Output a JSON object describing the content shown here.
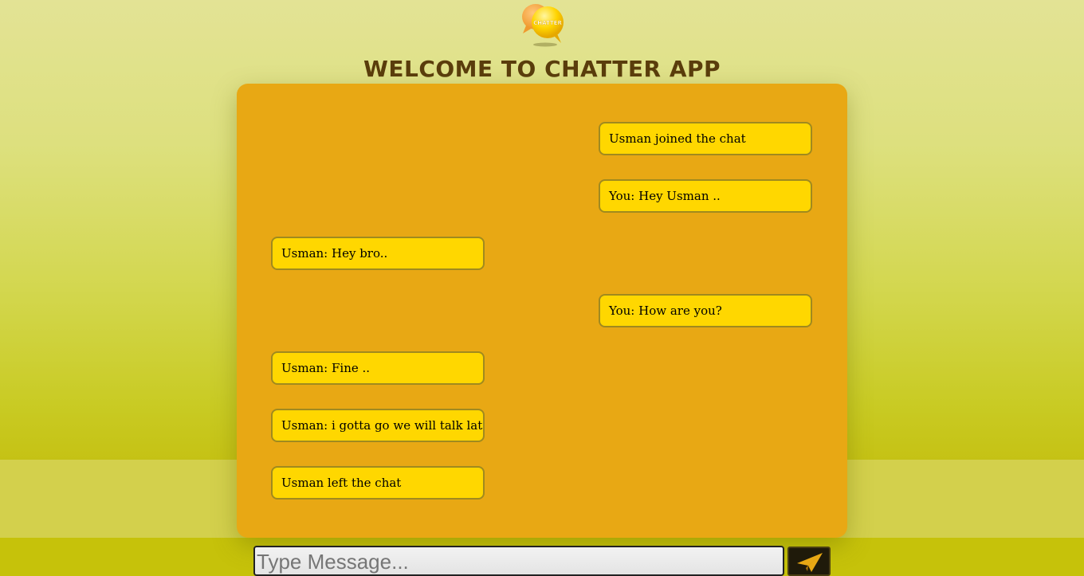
{
  "header": {
    "logo_text": "CHATTER",
    "title": "WELCOME TO CHATTER APP"
  },
  "messages": [
    {
      "side": "right",
      "text": "Usman joined the chat"
    },
    {
      "side": "right",
      "text": "You: Hey Usman .."
    },
    {
      "side": "left",
      "text": "Usman: Hey bro.."
    },
    {
      "side": "right",
      "text": "You: How are you?"
    },
    {
      "side": "left",
      "text": "Usman: Fine .."
    },
    {
      "side": "left",
      "text": "Usman: i gotta go we will talk later"
    },
    {
      "side": "left",
      "text": "Usman left the chat"
    }
  ],
  "composer": {
    "placeholder": "Type Message...",
    "value": "",
    "send_icon": "paper-plane-icon"
  },
  "colors": {
    "panel": "#e8a814",
    "bubble": "#ffd700",
    "bubble_border": "#a08a1e",
    "title": "#5a3d0c"
  }
}
